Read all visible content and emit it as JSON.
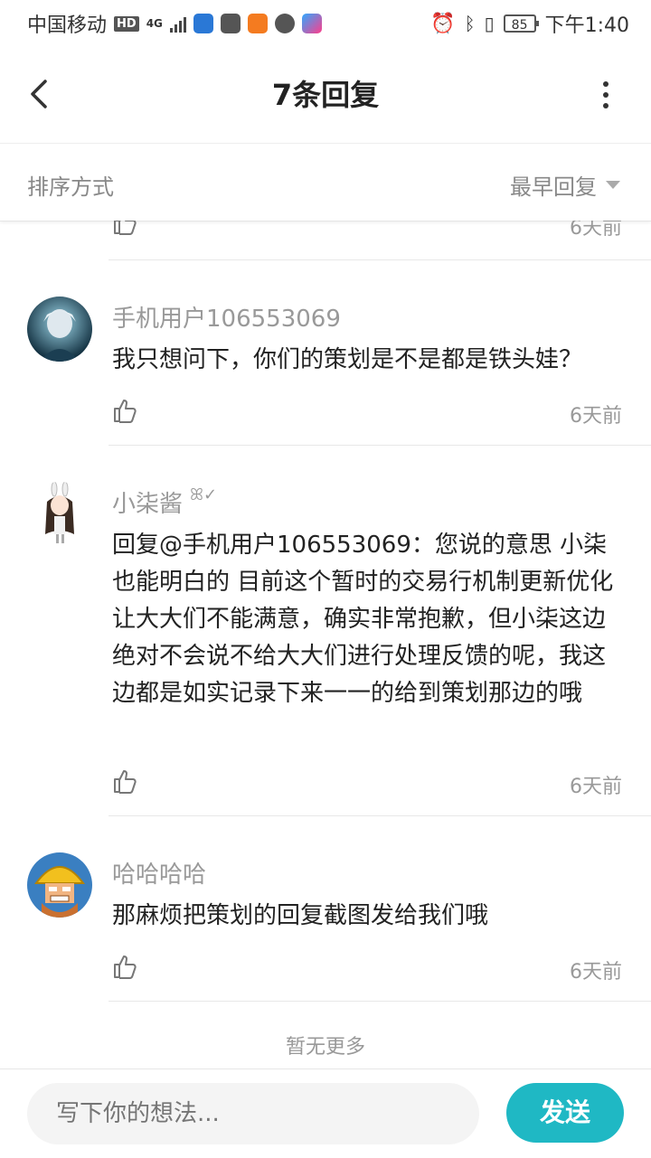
{
  "status_bar": {
    "carrier": "中国移动",
    "hd": "HD",
    "network": "4G",
    "battery": "85",
    "time": "下午1:40"
  },
  "nav": {
    "title": "7条回复",
    "back_icon": "chevron-left-icon",
    "more_icon": "more-vertical-icon"
  },
  "sort": {
    "label": "排序方式",
    "value": "最早回复"
  },
  "partial_item": {
    "time": "6天前"
  },
  "comments": [
    {
      "user": "手机用户106553069",
      "text": "我只想问下，你们的策划是不是都是铁头娃？",
      "time": "6天前"
    },
    {
      "user": "小柒酱",
      "text": "回复@手机用户106553069：您说的意思 小柒也能明白的 目前这个暂时的交易行机制更新优化让大大们不能满意，确实非常抱歉，但小柒这边绝对不会说不给大大们进行处理反馈的呢，我这边都是如实记录下来一一的给到策划那边的哦",
      "time": "6天前"
    },
    {
      "user": "哈哈哈哈",
      "text": "那麻烦把策划的回复截图发给我们哦",
      "time": "6天前"
    }
  ],
  "footer": {
    "no_more": "暂无更多",
    "input_placeholder": "写下你的想法...",
    "send_label": "发送"
  },
  "colors": {
    "accent": "#1fb8c4",
    "muted_text": "#999999"
  }
}
